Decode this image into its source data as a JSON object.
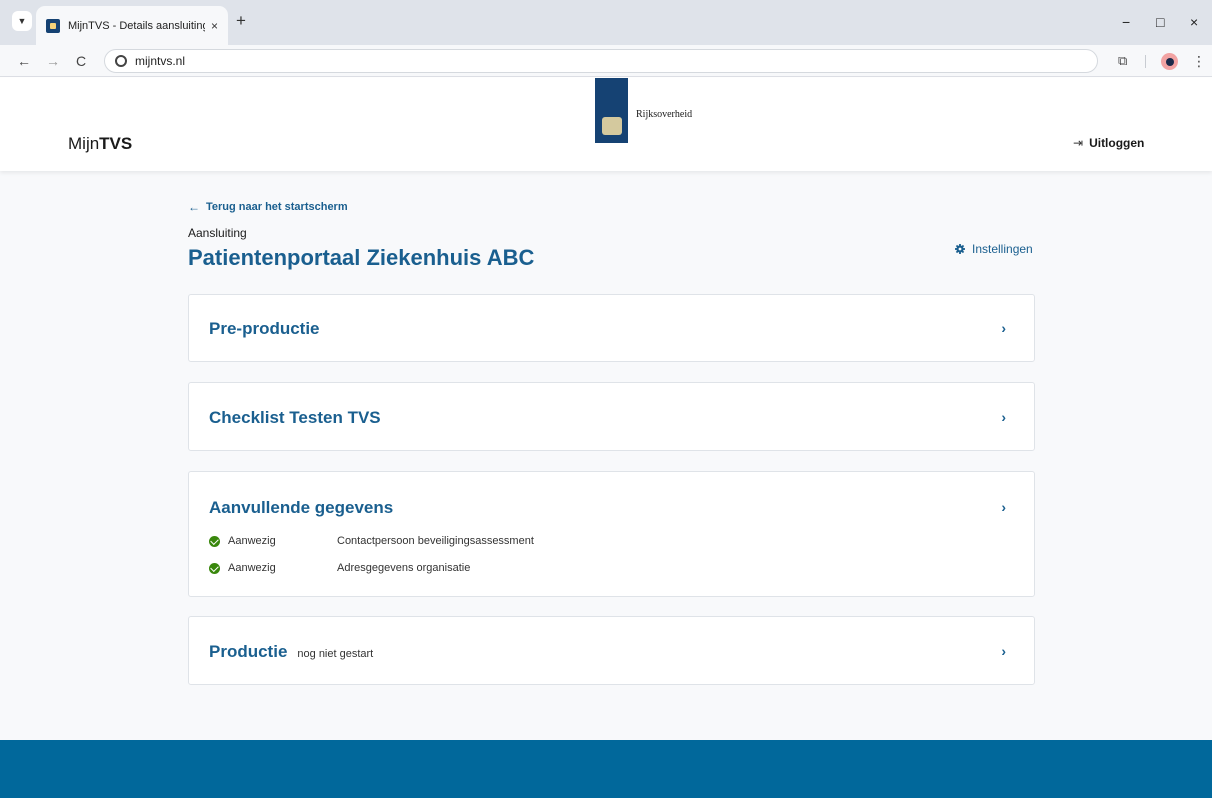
{
  "browser": {
    "tab_title": "MijnTVS - Details aansluiting",
    "tab_close": "×",
    "new_tab": "+",
    "url": "mijntvs.nl",
    "controls": {
      "minimize": "−",
      "maximize": "□",
      "close": "×"
    },
    "nav": {
      "back": "←",
      "forward": "→",
      "reload": "C"
    }
  },
  "header": {
    "brand_prefix": "Mijn",
    "brand_strong": "TVS",
    "logo_text": "Rijksoverheid",
    "logout_label": "Uitloggen",
    "logout_icon": "⇥"
  },
  "main": {
    "back_link": "Terug naar het startscherm",
    "crumb_label": "Aansluiting",
    "title": "Patientenportaal Ziekenhuis ABC",
    "settings_label": "Instellingen",
    "cards": [
      {
        "title": "Pre-productie"
      },
      {
        "title": "Checklist Testen TVS"
      },
      {
        "title": "Aanvullende gegevens",
        "items": [
          {
            "status": "Aanwezig",
            "label": "Contactpersoon beveiligingsassessment"
          },
          {
            "status": "Aanwezig",
            "label": "Adresgegevens organisatie"
          }
        ]
      },
      {
        "title": "Productie",
        "status": "nog niet gestart"
      }
    ]
  },
  "colors": {
    "primary": "#1a5f8f",
    "footer": "#01689b",
    "logo": "#154273",
    "success": "#39870c"
  }
}
